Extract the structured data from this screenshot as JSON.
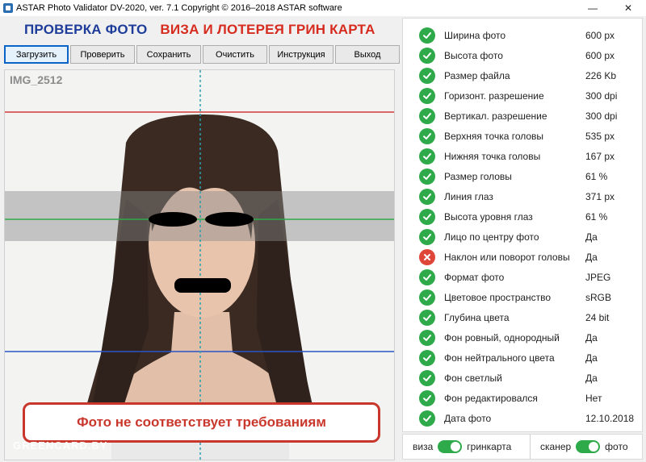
{
  "window": {
    "title": "ASTAR Photo Validator DV-2020, ver. 7.1  Copyright © 2016–2018 ASTAR software",
    "minimize": "—",
    "close": "✕"
  },
  "header": {
    "check_photo": "ПРОВЕРКА ФОТО",
    "visa_lottery": "ВИЗА И ЛОТЕРЕЯ ГРИН КАРТА"
  },
  "toolbar": {
    "load": "Загрузить",
    "check": "Проверить",
    "save": "Сохранить",
    "clear": "Очистить",
    "instructions": "Инструкция",
    "exit": "Выход"
  },
  "photo": {
    "filename": "IMG_2512",
    "alert": "Фото не соответствует требованиям",
    "watermark": "GREENCARD.BY"
  },
  "checks": [
    {
      "label": "Ширина фото",
      "value": "600 px",
      "status": "ok"
    },
    {
      "label": "Высота фото",
      "value": "600 px",
      "status": "ok"
    },
    {
      "label": "Размер файла",
      "value": "226 Kb",
      "status": "ok"
    },
    {
      "label": "Горизонт. разрешение",
      "value": "300 dpi",
      "status": "ok"
    },
    {
      "label": "Вертикал. разрешение",
      "value": "300 dpi",
      "status": "ok"
    },
    {
      "label": "Верхняя точка головы",
      "value": "535 px",
      "status": "ok"
    },
    {
      "label": "Нижняя точка головы",
      "value": "167 px",
      "status": "ok"
    },
    {
      "label": "Размер головы",
      "value": "61 %",
      "status": "ok"
    },
    {
      "label": "Линия глаз",
      "value": "371 px",
      "status": "ok"
    },
    {
      "label": "Высота уровня глаз",
      "value": "61 %",
      "status": "ok"
    },
    {
      "label": "Лицо по центру фото",
      "value": "Да",
      "status": "ok"
    },
    {
      "label": "Наклон или поворот головы",
      "value": "Да",
      "status": "bad"
    },
    {
      "label": "Формат фото",
      "value": "JPEG",
      "status": "ok"
    },
    {
      "label": "Цветовое пространство",
      "value": "sRGB",
      "status": "ok"
    },
    {
      "label": "Глубина цвета",
      "value": "24 bit",
      "status": "ok"
    },
    {
      "label": "Фон ровный, однородный",
      "value": "Да",
      "status": "ok"
    },
    {
      "label": "Фон нейтрального цвета",
      "value": "Да",
      "status": "ok"
    },
    {
      "label": "Фон светлый",
      "value": "Да",
      "status": "ok"
    },
    {
      "label": "Фон редактировался",
      "value": "Нет",
      "status": "ok"
    },
    {
      "label": "Дата фото",
      "value": "12.10.2018",
      "status": "ok"
    }
  ],
  "toggles": {
    "visa": "виза",
    "greencard": "гринкарта",
    "scanner": "сканер",
    "photo": "фото"
  },
  "colors": {
    "ok": "#2eaa4a",
    "bad": "#e0453a",
    "header_blue": "#1e3c9a",
    "header_red": "#d62b1e"
  }
}
